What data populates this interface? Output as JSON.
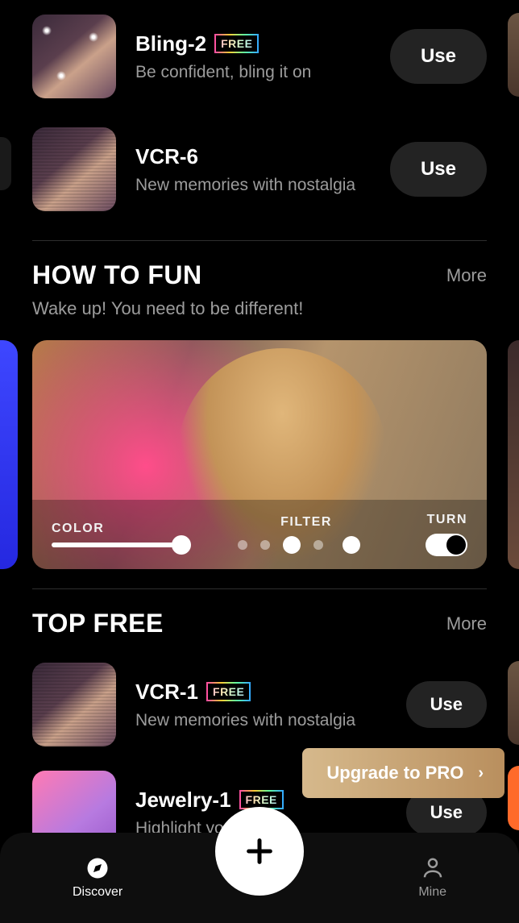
{
  "filters_top": [
    {
      "name": "Bling-2",
      "badge": "FREE",
      "subtitle": "Be confident, bling it on",
      "use_label": "Use"
    },
    {
      "name": "VCR-6",
      "badge": null,
      "subtitle": "New memories with nostalgia",
      "use_label": "Use"
    }
  ],
  "how_to_fun": {
    "title": "HOW TO FUN",
    "subtitle": "Wake up! You need to be different!",
    "more_label": "More",
    "controls": {
      "color_label": "COLOR",
      "filter_label": "FILTER",
      "turn_label": "TURN"
    }
  },
  "top_free": {
    "title": "TOP FREE",
    "more_label": "More",
    "items": [
      {
        "name": "VCR-1",
        "badge": "FREE",
        "subtitle": "New memories with nostalgia",
        "use_label": "Use"
      },
      {
        "name": "Jewelry-1",
        "badge": "FREE",
        "subtitle": "Highlight your beauty",
        "use_label": "Use"
      }
    ]
  },
  "upgrade": {
    "label": "Upgrade to PRO"
  },
  "nav": {
    "discover": "Discover",
    "mine": "Mine"
  }
}
